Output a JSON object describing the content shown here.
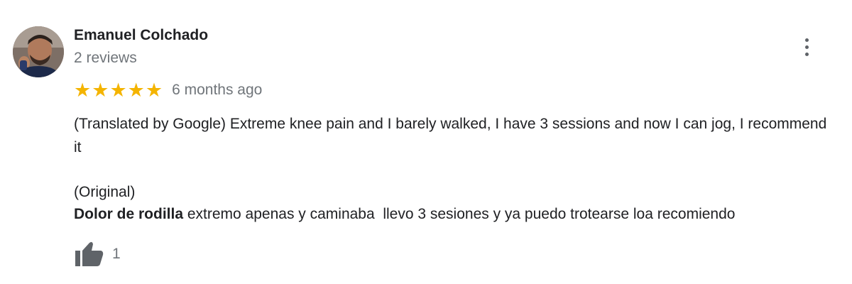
{
  "reviewer": {
    "name": "Emanuel Colchado",
    "review_count": "2 reviews",
    "avatar_icon": "user-photo"
  },
  "menu": {
    "icon": "more-vert-icon"
  },
  "rating": {
    "stars": 5,
    "max": 5,
    "star_char": "★",
    "star_color": "#f4b400",
    "date": "6 months ago"
  },
  "review": {
    "translated_text": "(Translated by Google) Extreme knee pain and I barely walked, I have 3 sessions and now I can jog, I recommend it",
    "original_label": "(Original)",
    "original_bold": "Dolor de rodilla",
    "original_rest": " extremo apenas y caminaba  llevo 3 sesiones y ya puedo trotearse loa recomiendo"
  },
  "actions": {
    "like_icon": "thumbs-up-icon",
    "like_count": "1"
  }
}
